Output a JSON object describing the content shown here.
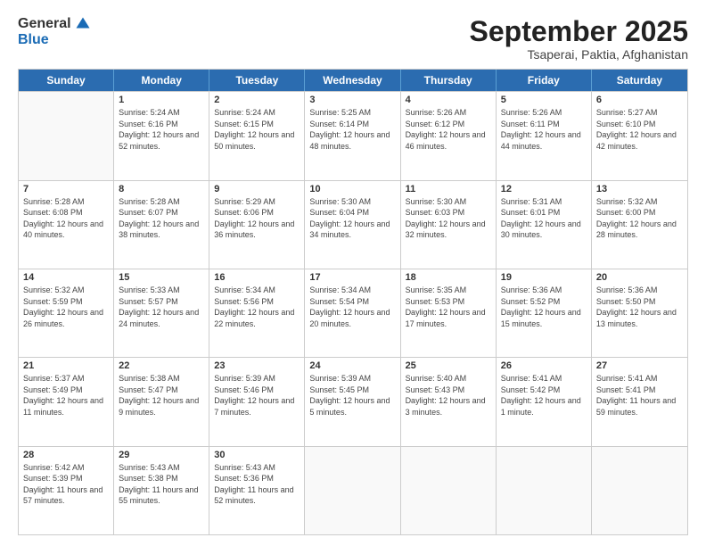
{
  "logo": {
    "general": "General",
    "blue": "Blue"
  },
  "title": "September 2025",
  "location": "Tsaperai, Paktia, Afghanistan",
  "days": [
    "Sunday",
    "Monday",
    "Tuesday",
    "Wednesday",
    "Thursday",
    "Friday",
    "Saturday"
  ],
  "weeks": [
    [
      {
        "day": "",
        "sunrise": "",
        "sunset": "",
        "daylight": ""
      },
      {
        "day": "1",
        "sunrise": "Sunrise: 5:24 AM",
        "sunset": "Sunset: 6:16 PM",
        "daylight": "Daylight: 12 hours and 52 minutes."
      },
      {
        "day": "2",
        "sunrise": "Sunrise: 5:24 AM",
        "sunset": "Sunset: 6:15 PM",
        "daylight": "Daylight: 12 hours and 50 minutes."
      },
      {
        "day": "3",
        "sunrise": "Sunrise: 5:25 AM",
        "sunset": "Sunset: 6:14 PM",
        "daylight": "Daylight: 12 hours and 48 minutes."
      },
      {
        "day": "4",
        "sunrise": "Sunrise: 5:26 AM",
        "sunset": "Sunset: 6:12 PM",
        "daylight": "Daylight: 12 hours and 46 minutes."
      },
      {
        "day": "5",
        "sunrise": "Sunrise: 5:26 AM",
        "sunset": "Sunset: 6:11 PM",
        "daylight": "Daylight: 12 hours and 44 minutes."
      },
      {
        "day": "6",
        "sunrise": "Sunrise: 5:27 AM",
        "sunset": "Sunset: 6:10 PM",
        "daylight": "Daylight: 12 hours and 42 minutes."
      }
    ],
    [
      {
        "day": "7",
        "sunrise": "Sunrise: 5:28 AM",
        "sunset": "Sunset: 6:08 PM",
        "daylight": "Daylight: 12 hours and 40 minutes."
      },
      {
        "day": "8",
        "sunrise": "Sunrise: 5:28 AM",
        "sunset": "Sunset: 6:07 PM",
        "daylight": "Daylight: 12 hours and 38 minutes."
      },
      {
        "day": "9",
        "sunrise": "Sunrise: 5:29 AM",
        "sunset": "Sunset: 6:06 PM",
        "daylight": "Daylight: 12 hours and 36 minutes."
      },
      {
        "day": "10",
        "sunrise": "Sunrise: 5:30 AM",
        "sunset": "Sunset: 6:04 PM",
        "daylight": "Daylight: 12 hours and 34 minutes."
      },
      {
        "day": "11",
        "sunrise": "Sunrise: 5:30 AM",
        "sunset": "Sunset: 6:03 PM",
        "daylight": "Daylight: 12 hours and 32 minutes."
      },
      {
        "day": "12",
        "sunrise": "Sunrise: 5:31 AM",
        "sunset": "Sunset: 6:01 PM",
        "daylight": "Daylight: 12 hours and 30 minutes."
      },
      {
        "day": "13",
        "sunrise": "Sunrise: 5:32 AM",
        "sunset": "Sunset: 6:00 PM",
        "daylight": "Daylight: 12 hours and 28 minutes."
      }
    ],
    [
      {
        "day": "14",
        "sunrise": "Sunrise: 5:32 AM",
        "sunset": "Sunset: 5:59 PM",
        "daylight": "Daylight: 12 hours and 26 minutes."
      },
      {
        "day": "15",
        "sunrise": "Sunrise: 5:33 AM",
        "sunset": "Sunset: 5:57 PM",
        "daylight": "Daylight: 12 hours and 24 minutes."
      },
      {
        "day": "16",
        "sunrise": "Sunrise: 5:34 AM",
        "sunset": "Sunset: 5:56 PM",
        "daylight": "Daylight: 12 hours and 22 minutes."
      },
      {
        "day": "17",
        "sunrise": "Sunrise: 5:34 AM",
        "sunset": "Sunset: 5:54 PM",
        "daylight": "Daylight: 12 hours and 20 minutes."
      },
      {
        "day": "18",
        "sunrise": "Sunrise: 5:35 AM",
        "sunset": "Sunset: 5:53 PM",
        "daylight": "Daylight: 12 hours and 17 minutes."
      },
      {
        "day": "19",
        "sunrise": "Sunrise: 5:36 AM",
        "sunset": "Sunset: 5:52 PM",
        "daylight": "Daylight: 12 hours and 15 minutes."
      },
      {
        "day": "20",
        "sunrise": "Sunrise: 5:36 AM",
        "sunset": "Sunset: 5:50 PM",
        "daylight": "Daylight: 12 hours and 13 minutes."
      }
    ],
    [
      {
        "day": "21",
        "sunrise": "Sunrise: 5:37 AM",
        "sunset": "Sunset: 5:49 PM",
        "daylight": "Daylight: 12 hours and 11 minutes."
      },
      {
        "day": "22",
        "sunrise": "Sunrise: 5:38 AM",
        "sunset": "Sunset: 5:47 PM",
        "daylight": "Daylight: 12 hours and 9 minutes."
      },
      {
        "day": "23",
        "sunrise": "Sunrise: 5:39 AM",
        "sunset": "Sunset: 5:46 PM",
        "daylight": "Daylight: 12 hours and 7 minutes."
      },
      {
        "day": "24",
        "sunrise": "Sunrise: 5:39 AM",
        "sunset": "Sunset: 5:45 PM",
        "daylight": "Daylight: 12 hours and 5 minutes."
      },
      {
        "day": "25",
        "sunrise": "Sunrise: 5:40 AM",
        "sunset": "Sunset: 5:43 PM",
        "daylight": "Daylight: 12 hours and 3 minutes."
      },
      {
        "day": "26",
        "sunrise": "Sunrise: 5:41 AM",
        "sunset": "Sunset: 5:42 PM",
        "daylight": "Daylight: 12 hours and 1 minute."
      },
      {
        "day": "27",
        "sunrise": "Sunrise: 5:41 AM",
        "sunset": "Sunset: 5:41 PM",
        "daylight": "Daylight: 11 hours and 59 minutes."
      }
    ],
    [
      {
        "day": "28",
        "sunrise": "Sunrise: 5:42 AM",
        "sunset": "Sunset: 5:39 PM",
        "daylight": "Daylight: 11 hours and 57 minutes."
      },
      {
        "day": "29",
        "sunrise": "Sunrise: 5:43 AM",
        "sunset": "Sunset: 5:38 PM",
        "daylight": "Daylight: 11 hours and 55 minutes."
      },
      {
        "day": "30",
        "sunrise": "Sunrise: 5:43 AM",
        "sunset": "Sunset: 5:36 PM",
        "daylight": "Daylight: 11 hours and 52 minutes."
      },
      {
        "day": "",
        "sunrise": "",
        "sunset": "",
        "daylight": ""
      },
      {
        "day": "",
        "sunrise": "",
        "sunset": "",
        "daylight": ""
      },
      {
        "day": "",
        "sunrise": "",
        "sunset": "",
        "daylight": ""
      },
      {
        "day": "",
        "sunrise": "",
        "sunset": "",
        "daylight": ""
      }
    ]
  ]
}
